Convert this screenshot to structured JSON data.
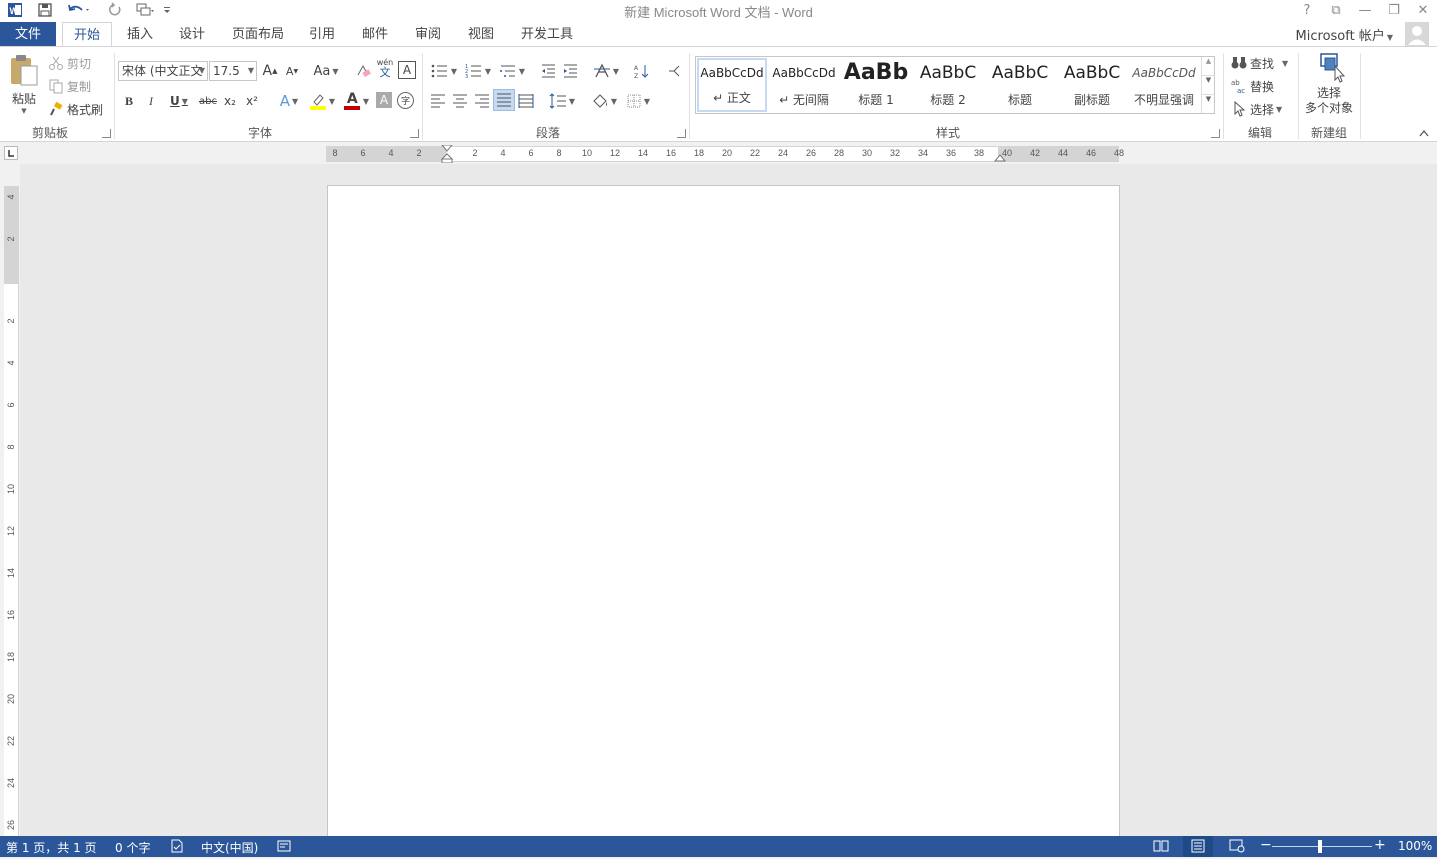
{
  "window": {
    "title": "新建 Microsoft Word 文档 - Word",
    "controls": {
      "help": "?",
      "ribbon_display": "⧉",
      "minimize": "—",
      "restore": "❐",
      "close": "✕"
    }
  },
  "tabs": [
    {
      "label": "文件"
    },
    {
      "label": "开始"
    },
    {
      "label": "插入"
    },
    {
      "label": "设计"
    },
    {
      "label": "页面布局"
    },
    {
      "label": "引用"
    },
    {
      "label": "邮件"
    },
    {
      "label": "审阅"
    },
    {
      "label": "视图"
    },
    {
      "label": "开发工具"
    }
  ],
  "account": {
    "label": "Microsoft 帐户"
  },
  "clipboard": {
    "group_label": "剪贴板",
    "paste": "粘贴",
    "cut": "剪切",
    "copy": "复制",
    "format_painter": "格式刷"
  },
  "font": {
    "group_label": "字体",
    "font_name": "宋体 (中文正文",
    "font_size": "17.5",
    "change_case": "Aa",
    "bold": "B",
    "italic": "I",
    "underline": "U",
    "strikethrough": "abc",
    "subscript": "x₂",
    "superscript": "x²",
    "phonetic": "wén",
    "phonetic_char": "文",
    "char_border": "A",
    "text_effects": "A",
    "font_color": "A",
    "char_shading": "A",
    "enclose": "字",
    "grow": "A",
    "shrink": "A"
  },
  "paragraph": {
    "group_label": "段落"
  },
  "styles": {
    "group_label": "样式",
    "items": [
      {
        "sample": "AaBbCcDd",
        "name": "↵ 正文"
      },
      {
        "sample": "AaBbCcDd",
        "name": "↵ 无间隔"
      },
      {
        "sample": "AaBb",
        "name": "标题 1"
      },
      {
        "sample": "AaBbC",
        "name": "标题 2"
      },
      {
        "sample": "AaBbC",
        "name": "标题"
      },
      {
        "sample": "AaBbC",
        "name": "副标题"
      },
      {
        "sample": "AaBbCcDd",
        "name": "不明显强调"
      }
    ]
  },
  "editing": {
    "group_label": "编辑",
    "find": "查找",
    "replace": "替换",
    "select": "选择"
  },
  "new_group": {
    "group_label": "新建组",
    "select_multi_line1": "选择",
    "select_multi_line2": "多个对象"
  },
  "ruler": {
    "h_ticks": [
      "8",
      "6",
      "4",
      "2",
      "2",
      "4",
      "6",
      "8",
      "10",
      "12",
      "14",
      "16",
      "18",
      "20",
      "22",
      "24",
      "26",
      "28",
      "30",
      "32",
      "34",
      "36",
      "38",
      "40",
      "42",
      "44",
      "46",
      "48"
    ],
    "v_ticks": [
      "4",
      "2",
      "2",
      "4",
      "6",
      "8",
      "10",
      "12",
      "14",
      "16",
      "18",
      "20",
      "22",
      "24",
      "26"
    ]
  },
  "status": {
    "page": "第 1 页，共 1 页",
    "words": "0 个字",
    "language": "中文(中国)",
    "zoom": "100%",
    "zoom_minus": "−",
    "zoom_plus": "+"
  },
  "colors": {
    "accent": "#2b579a",
    "font_color_bar": "#c00000",
    "highlight_bar": "#ffff00"
  }
}
